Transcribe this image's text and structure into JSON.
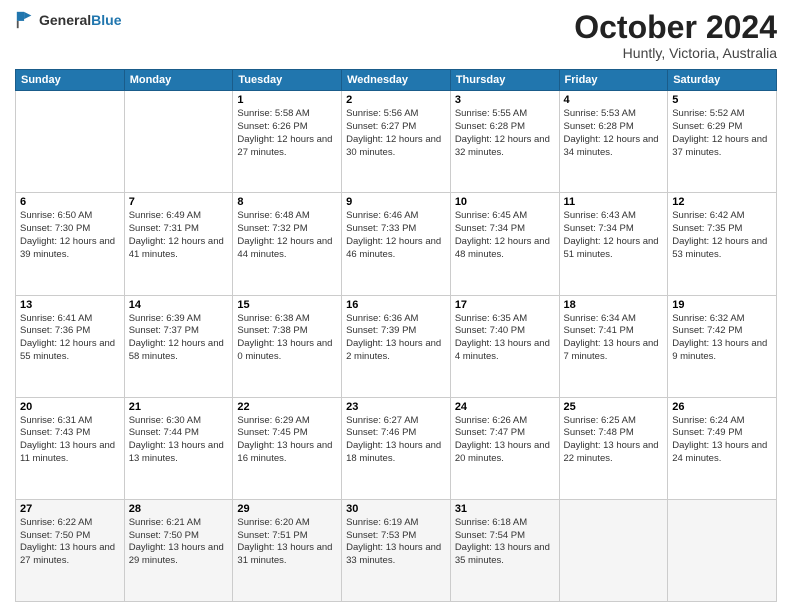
{
  "header": {
    "logo_line1": "General",
    "logo_line2": "Blue",
    "month": "October 2024",
    "location": "Huntly, Victoria, Australia"
  },
  "weekdays": [
    "Sunday",
    "Monday",
    "Tuesday",
    "Wednesday",
    "Thursday",
    "Friday",
    "Saturday"
  ],
  "weeks": [
    [
      {
        "day": "",
        "info": ""
      },
      {
        "day": "",
        "info": ""
      },
      {
        "day": "1",
        "info": "Sunrise: 5:58 AM\nSunset: 6:26 PM\nDaylight: 12 hours\nand 27 minutes."
      },
      {
        "day": "2",
        "info": "Sunrise: 5:56 AM\nSunset: 6:27 PM\nDaylight: 12 hours\nand 30 minutes."
      },
      {
        "day": "3",
        "info": "Sunrise: 5:55 AM\nSunset: 6:28 PM\nDaylight: 12 hours\nand 32 minutes."
      },
      {
        "day": "4",
        "info": "Sunrise: 5:53 AM\nSunset: 6:28 PM\nDaylight: 12 hours\nand 34 minutes."
      },
      {
        "day": "5",
        "info": "Sunrise: 5:52 AM\nSunset: 6:29 PM\nDaylight: 12 hours\nand 37 minutes."
      }
    ],
    [
      {
        "day": "6",
        "info": "Sunrise: 6:50 AM\nSunset: 7:30 PM\nDaylight: 12 hours\nand 39 minutes."
      },
      {
        "day": "7",
        "info": "Sunrise: 6:49 AM\nSunset: 7:31 PM\nDaylight: 12 hours\nand 41 minutes."
      },
      {
        "day": "8",
        "info": "Sunrise: 6:48 AM\nSunset: 7:32 PM\nDaylight: 12 hours\nand 44 minutes."
      },
      {
        "day": "9",
        "info": "Sunrise: 6:46 AM\nSunset: 7:33 PM\nDaylight: 12 hours\nand 46 minutes."
      },
      {
        "day": "10",
        "info": "Sunrise: 6:45 AM\nSunset: 7:34 PM\nDaylight: 12 hours\nand 48 minutes."
      },
      {
        "day": "11",
        "info": "Sunrise: 6:43 AM\nSunset: 7:34 PM\nDaylight: 12 hours\nand 51 minutes."
      },
      {
        "day": "12",
        "info": "Sunrise: 6:42 AM\nSunset: 7:35 PM\nDaylight: 12 hours\nand 53 minutes."
      }
    ],
    [
      {
        "day": "13",
        "info": "Sunrise: 6:41 AM\nSunset: 7:36 PM\nDaylight: 12 hours\nand 55 minutes."
      },
      {
        "day": "14",
        "info": "Sunrise: 6:39 AM\nSunset: 7:37 PM\nDaylight: 12 hours\nand 58 minutes."
      },
      {
        "day": "15",
        "info": "Sunrise: 6:38 AM\nSunset: 7:38 PM\nDaylight: 13 hours\nand 0 minutes."
      },
      {
        "day": "16",
        "info": "Sunrise: 6:36 AM\nSunset: 7:39 PM\nDaylight: 13 hours\nand 2 minutes."
      },
      {
        "day": "17",
        "info": "Sunrise: 6:35 AM\nSunset: 7:40 PM\nDaylight: 13 hours\nand 4 minutes."
      },
      {
        "day": "18",
        "info": "Sunrise: 6:34 AM\nSunset: 7:41 PM\nDaylight: 13 hours\nand 7 minutes."
      },
      {
        "day": "19",
        "info": "Sunrise: 6:32 AM\nSunset: 7:42 PM\nDaylight: 13 hours\nand 9 minutes."
      }
    ],
    [
      {
        "day": "20",
        "info": "Sunrise: 6:31 AM\nSunset: 7:43 PM\nDaylight: 13 hours\nand 11 minutes."
      },
      {
        "day": "21",
        "info": "Sunrise: 6:30 AM\nSunset: 7:44 PM\nDaylight: 13 hours\nand 13 minutes."
      },
      {
        "day": "22",
        "info": "Sunrise: 6:29 AM\nSunset: 7:45 PM\nDaylight: 13 hours\nand 16 minutes."
      },
      {
        "day": "23",
        "info": "Sunrise: 6:27 AM\nSunset: 7:46 PM\nDaylight: 13 hours\nand 18 minutes."
      },
      {
        "day": "24",
        "info": "Sunrise: 6:26 AM\nSunset: 7:47 PM\nDaylight: 13 hours\nand 20 minutes."
      },
      {
        "day": "25",
        "info": "Sunrise: 6:25 AM\nSunset: 7:48 PM\nDaylight: 13 hours\nand 22 minutes."
      },
      {
        "day": "26",
        "info": "Sunrise: 6:24 AM\nSunset: 7:49 PM\nDaylight: 13 hours\nand 24 minutes."
      }
    ],
    [
      {
        "day": "27",
        "info": "Sunrise: 6:22 AM\nSunset: 7:50 PM\nDaylight: 13 hours\nand 27 minutes."
      },
      {
        "day": "28",
        "info": "Sunrise: 6:21 AM\nSunset: 7:50 PM\nDaylight: 13 hours\nand 29 minutes."
      },
      {
        "day": "29",
        "info": "Sunrise: 6:20 AM\nSunset: 7:51 PM\nDaylight: 13 hours\nand 31 minutes."
      },
      {
        "day": "30",
        "info": "Sunrise: 6:19 AM\nSunset: 7:53 PM\nDaylight: 13 hours\nand 33 minutes."
      },
      {
        "day": "31",
        "info": "Sunrise: 6:18 AM\nSunset: 7:54 PM\nDaylight: 13 hours\nand 35 minutes."
      },
      {
        "day": "",
        "info": ""
      },
      {
        "day": "",
        "info": ""
      }
    ]
  ]
}
